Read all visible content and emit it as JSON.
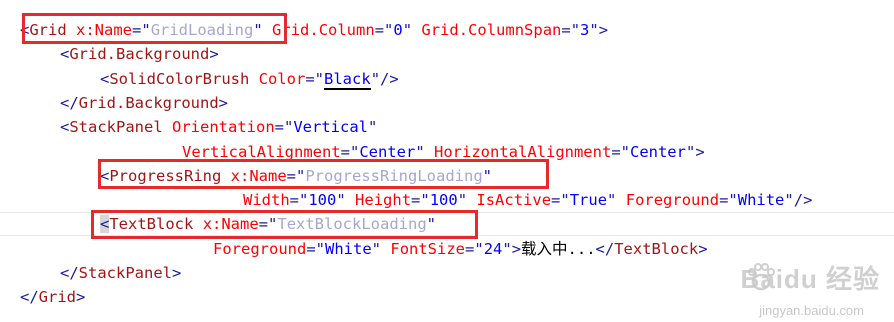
{
  "code": {
    "l1": {
      "lt": "<",
      "tag": "Grid",
      "sp1": " ",
      "attr1": "x:Name",
      "eq1": "=\"",
      "val1": "GridLoading",
      "q1": "\"",
      "sp2": " ",
      "attr2": "Grid.Column",
      "eq2": "=\"",
      "val2": "0",
      "q2": "\"",
      "sp3": " ",
      "attr3": "Grid.ColumnSpan",
      "eq3": "=\"",
      "val3": "3",
      "q3": "\"",
      "gt": ">"
    },
    "l2": {
      "lt": "<",
      "tag": "Grid.Background",
      "gt": ">"
    },
    "l3": {
      "lt": "<",
      "tag": "SolidColorBrush",
      "sp": " ",
      "attr": "Color",
      "eq": "=\"",
      "val": "Black",
      "q": "\"",
      "end": "/>"
    },
    "l4": {
      "lt": "</",
      "tag": "Grid.Background",
      "gt": ">"
    },
    "l5": {
      "lt": "<",
      "tag": "StackPanel",
      "sp": " ",
      "attr": "Orientation",
      "eq": "=\"",
      "val": "Vertical",
      "q": "\""
    },
    "l6": {
      "attr1": "VerticalAlignment",
      "eq1": "=\"",
      "val1": "Center",
      "q1": "\"",
      "sp": " ",
      "attr2": "HorizontalAlignment",
      "eq2": "=\"",
      "val2": "Center",
      "q2": "\"",
      "gt": ">"
    },
    "l7": {
      "lt": "<",
      "tag": "ProgressRing",
      "sp": " ",
      "attr": "x:Name",
      "eq": "=\"",
      "val": "ProgressRingLoading",
      "q": "\""
    },
    "l8": {
      "attr1": "Width",
      "eq1": "=\"",
      "val1": "100",
      "q1": "\"",
      "sp1": " ",
      "attr2": "Height",
      "eq2": "=\"",
      "val2": "100",
      "q2": "\"",
      "sp2": " ",
      "attr3": "IsActive",
      "eq3": "=\"",
      "val3": "True",
      "q3": "\"",
      "sp3": " ",
      "attr4": "Foreground",
      "eq4": "=\"",
      "val4": "White",
      "q4": "\"",
      "end": "/>"
    },
    "l9": {
      "lt": "<",
      "tag": "TextBlock",
      "sp": " ",
      "attr": "x:Name",
      "eq": "=\"",
      "val": "TextBlockLoading",
      "q": "\""
    },
    "l10": {
      "attr1": "Foreground",
      "eq1": "=\"",
      "val1": "White",
      "q1": "\"",
      "sp": " ",
      "attr2": "FontSize",
      "eq2": "=\"",
      "val2": "24",
      "q2": "\"",
      "gt": ">",
      "text": "载入中...",
      "clt": "</",
      "ctag": "TextBlock",
      "cgt": ">"
    },
    "l11": {
      "lt": "</",
      "tag": "StackPanel",
      "gt": ">"
    },
    "l12": {
      "lt": "</",
      "tag": "Grid",
      "gt": ">"
    }
  },
  "watermark": {
    "brand": "Baidu 经验",
    "url": "jingyan.baidu.com"
  }
}
